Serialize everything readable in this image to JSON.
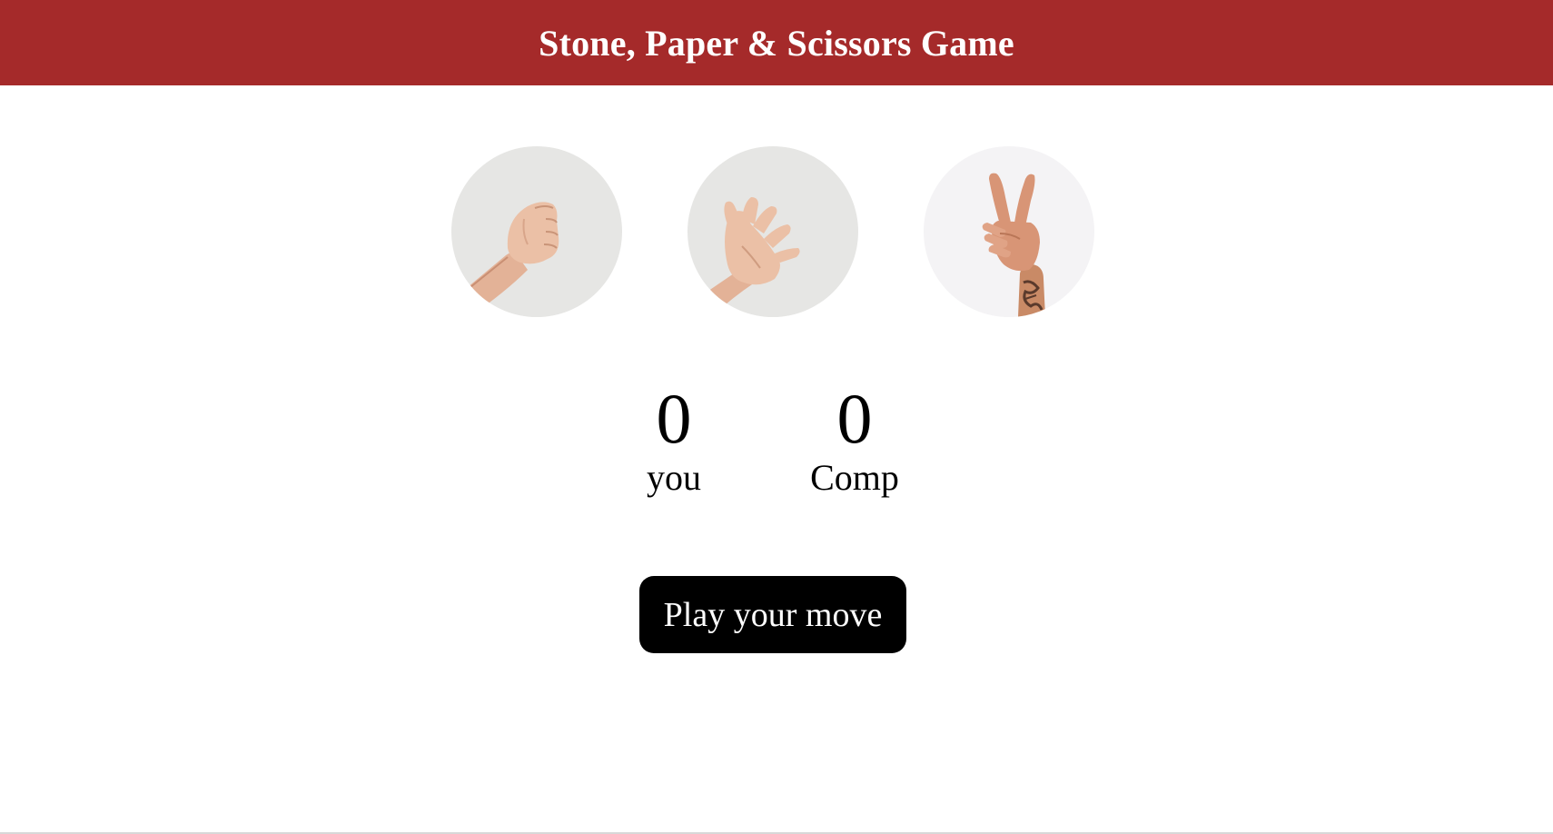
{
  "header": {
    "title": "Stone, Paper & Scissors Game",
    "background_color": "#a52a2a"
  },
  "choices": [
    {
      "id": "rock",
      "icon": "rock-hand-icon"
    },
    {
      "id": "paper",
      "icon": "paper-hand-icon"
    },
    {
      "id": "scissors",
      "icon": "scissors-hand-icon"
    }
  ],
  "scoreboard": {
    "user": {
      "score": "0",
      "label": "you"
    },
    "comp": {
      "score": "0",
      "label": "Comp"
    }
  },
  "message": {
    "text": "Play your move",
    "background_color": "#000000"
  }
}
